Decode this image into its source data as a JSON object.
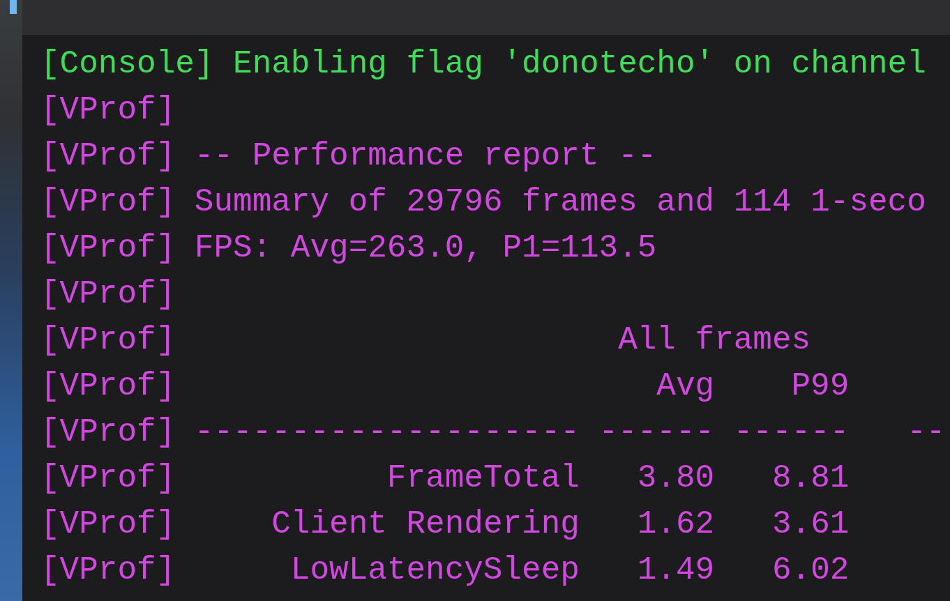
{
  "lines": [
    {
      "kind": "text",
      "color": "#3fdc5a",
      "tag": "[Console]",
      "text": "Enabling flag 'donotecho' on channel"
    },
    {
      "kind": "blank",
      "color": "#d247e0",
      "tag": "[VProf]"
    },
    {
      "kind": "text",
      "color": "#d247e0",
      "tag": "[VProf]",
      "text": "-- Performance report --"
    },
    {
      "kind": "text",
      "color": "#d247e0",
      "tag": "[VProf]",
      "text": "Summary of 29796 frames and 114 1-seco"
    },
    {
      "kind": "text",
      "color": "#d247e0",
      "tag": "[VProf]",
      "text": "FPS: Avg=263.0, P1=113.5"
    },
    {
      "kind": "blank",
      "color": "#d247e0",
      "tag": "[VProf]"
    },
    {
      "kind": "group",
      "color": "#d247e0",
      "tag": "[VProf]",
      "text": "All frames"
    },
    {
      "kind": "header",
      "color": "#d247e0",
      "tag": "[VProf]",
      "cells": [
        "Avg",
        "P99"
      ]
    },
    {
      "kind": "cells",
      "color": "#d247e0",
      "tag": "[VProf]",
      "cells": [
        "--------------------",
        "------",
        "------",
        "--"
      ]
    },
    {
      "kind": "cells",
      "color": "#d247e0",
      "tag": "[VProf]",
      "cells": [
        "FrameTotal",
        "3.80",
        "8.81"
      ]
    },
    {
      "kind": "cells",
      "color": "#d247e0",
      "tag": "[VProf]",
      "cells": [
        "Client Rendering",
        "1.62",
        "3.61"
      ]
    },
    {
      "kind": "cells",
      "color": "#d247e0",
      "tag": "[VProf]",
      "cells": [
        "LowLatencySleep",
        "1.49",
        "6.02"
      ]
    }
  ]
}
